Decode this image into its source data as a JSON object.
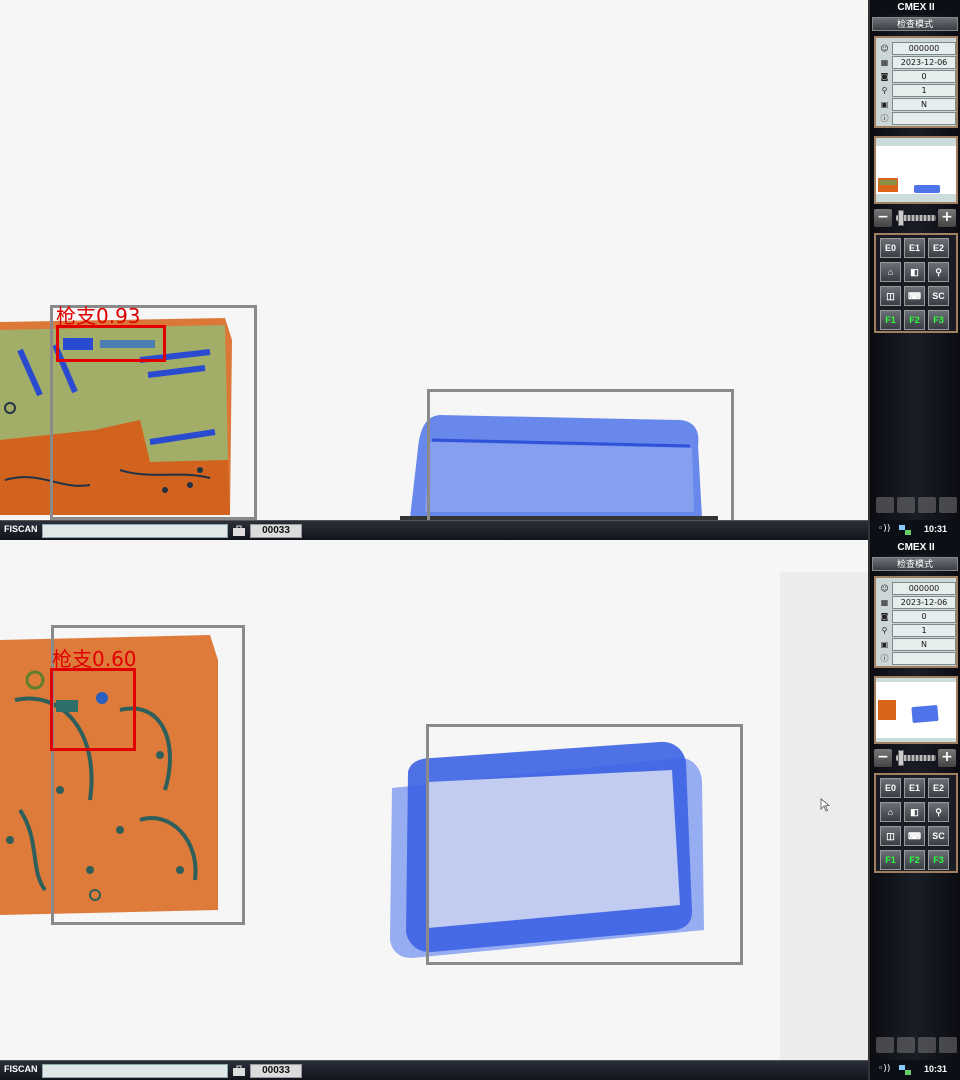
{
  "panels": [
    {
      "detections": [
        {
          "label": "枪支0.93"
        }
      ],
      "status": {
        "brand": "FISCAN",
        "counter": "00033"
      },
      "sidebar": {
        "title": "CMEX II",
        "mode": "检查模式",
        "info": [
          {
            "icon": "operator-icon",
            "value": "000000"
          },
          {
            "icon": "calendar-icon",
            "value": "2023-12-06"
          },
          {
            "icon": "count-icon",
            "value": "0"
          },
          {
            "icon": "magnifier-icon",
            "value": "1"
          },
          {
            "icon": "bag-type-icon",
            "value": "N"
          },
          {
            "icon": "info-icon",
            "value": ""
          }
        ],
        "buttons": [
          {
            "label": "E0",
            "icon": "e0-button"
          },
          {
            "label": "E1",
            "icon": "e1-button"
          },
          {
            "label": "E2",
            "icon": "e2-button"
          },
          {
            "label": "",
            "icon": "home-icon"
          },
          {
            "label": "",
            "icon": "contrast-icon"
          },
          {
            "label": "",
            "icon": "zoom-icon"
          },
          {
            "label": "",
            "icon": "split-icon"
          },
          {
            "label": "",
            "icon": "keyboard-icon"
          },
          {
            "label": "SC",
            "icon": "sc-button"
          },
          {
            "label": "F1",
            "icon": "f1-button"
          },
          {
            "label": "F2",
            "icon": "f2-button"
          },
          {
            "label": "F3",
            "icon": "f3-button"
          }
        ],
        "time": "10:31"
      }
    },
    {
      "detections": [
        {
          "label": "枪支0.60"
        }
      ],
      "status": {
        "brand": "FISCAN",
        "counter": "00033"
      },
      "sidebar": {
        "title": "CMEX II",
        "mode": "检查模式",
        "info": [
          {
            "icon": "operator-icon",
            "value": "000000"
          },
          {
            "icon": "calendar-icon",
            "value": "2023-12-06"
          },
          {
            "icon": "count-icon",
            "value": "0"
          },
          {
            "icon": "magnifier-icon",
            "value": "1"
          },
          {
            "icon": "bag-type-icon",
            "value": "N"
          },
          {
            "icon": "info-icon",
            "value": ""
          }
        ],
        "buttons": [
          {
            "label": "E0",
            "icon": "e0-button"
          },
          {
            "label": "E1",
            "icon": "e1-button"
          },
          {
            "label": "E2",
            "icon": "e2-button"
          },
          {
            "label": "",
            "icon": "home-icon"
          },
          {
            "label": "",
            "icon": "contrast-icon"
          },
          {
            "label": "",
            "icon": "zoom-icon"
          },
          {
            "label": "",
            "icon": "split-icon"
          },
          {
            "label": "",
            "icon": "keyboard-icon"
          },
          {
            "label": "SC",
            "icon": "sc-button"
          },
          {
            "label": "F1",
            "icon": "f1-button"
          },
          {
            "label": "F2",
            "icon": "f2-button"
          },
          {
            "label": "F3",
            "icon": "f3-button"
          }
        ],
        "time": "10:31"
      }
    }
  ],
  "colors": {
    "alert": "#e00000",
    "detection_box": "#8a8a8a",
    "tray_blue": "#3a5ee0",
    "organic_orange": "#d9651a",
    "mixed_green": "#6aa35a",
    "function_key_green": "#2bff3a"
  }
}
